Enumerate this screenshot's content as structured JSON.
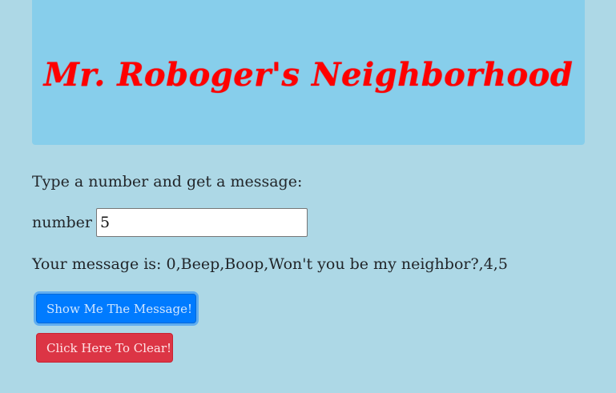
{
  "header": {
    "title": "Mr. Roboger's Neighborhood"
  },
  "form": {
    "prompt": "Type a number and get a message:",
    "number_label": "number",
    "number_value": "5"
  },
  "result": {
    "label": "Your message is:",
    "message": "0,Beep,Boop,Won't you be my neighbor?,4,5"
  },
  "buttons": {
    "show_label": "Show Me The Message!",
    "clear_label": "Click Here To Clear!"
  },
  "colors": {
    "background": "#add8e6",
    "header_background": "#87ceeb",
    "title": "#ff0000",
    "primary": "#007bff",
    "danger": "#dc3545"
  }
}
